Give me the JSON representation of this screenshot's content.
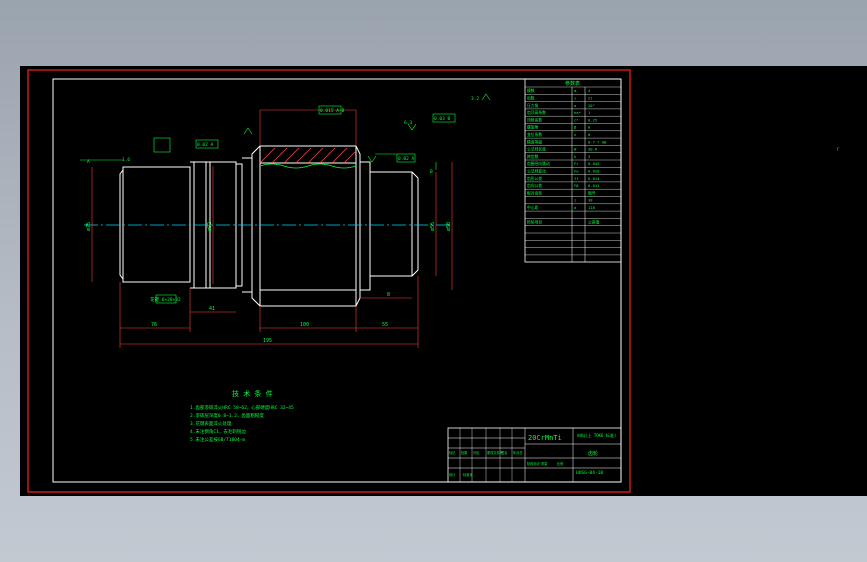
{
  "drawing": {
    "material": "20CrMnTi",
    "material_note": "材料(上 TOK6 标准)",
    "part_name": "齿轮",
    "drawing_number": "UUSG-04-10",
    "title_cells": [
      "标记",
      "处数",
      "分区",
      "更改文件号",
      "签名",
      "年月日"
    ],
    "bottom_cells": [
      "设计",
      "标准化",
      "阶段标记",
      "重量",
      "比例"
    ],
    "tech_title": "技 术 条 件",
    "tech_notes": [
      "1.齿部渗碳淬火HRC 58~62，心部硬度HRC 32~45",
      "2.渗碳层深度0.8~1.2，齿面粗糙度",
      "3.花键表面淬火处理",
      "4.未注倒角C1，去毛刺锐边",
      "5.未注公差按GB/T1804-m"
    ],
    "param_table_title": "参数表",
    "param_rows": [
      {
        "name": "模数",
        "sym": "m",
        "val": "4"
      },
      {
        "name": "齿数",
        "sym": "z",
        "val": "21"
      },
      {
        "name": "压力角",
        "sym": "α",
        "val": "20°"
      },
      {
        "name": "齿顶高系数",
        "sym": "ha*",
        "val": "1"
      },
      {
        "name": "顶隙系数",
        "sym": "c*",
        "val": "0.25"
      },
      {
        "name": "螺旋角",
        "sym": "β",
        "val": "0"
      },
      {
        "name": "变位系数",
        "sym": "x",
        "val": "0"
      },
      {
        "name": "精度等级",
        "sym": "",
        "val": "8-7-7 GB"
      },
      {
        "name": "公法线长度",
        "sym": "W",
        "val": "30.6"
      },
      {
        "name": "跨齿数",
        "sym": "k",
        "val": "3"
      },
      {
        "name": "齿圈径向跳动",
        "sym": "Fr",
        "val": "0.045"
      },
      {
        "name": "公法线变动",
        "sym": "Fw",
        "val": "0.028"
      },
      {
        "name": "齿形公差",
        "sym": "ff",
        "val": "0.014"
      },
      {
        "name": "齿向公差",
        "sym": "Fβ",
        "val": "0.011"
      },
      {
        "name": "配对齿轮",
        "sym": "",
        "val": "图号"
      },
      {
        "name": "",
        "sym": "z",
        "val": "38"
      },
      {
        "name": "中心距",
        "sym": "a",
        "val": "118"
      },
      {
        "name": "",
        "sym": "",
        "val": ""
      },
      {
        "name": "检验项目",
        "sym": "",
        "val": "公差值"
      },
      {
        "name": "",
        "sym": "",
        "val": ""
      },
      {
        "name": "",
        "sym": "",
        "val": ""
      },
      {
        "name": "",
        "sym": "",
        "val": ""
      },
      {
        "name": "",
        "sym": "",
        "val": ""
      },
      {
        "name": "",
        "sym": "",
        "val": ""
      }
    ],
    "dims": {
      "overall_len": "195",
      "len_left": "76",
      "len_center": "100",
      "len_right": "55",
      "len_spline": "41",
      "len_neck": "8",
      "dia_left": "ø75",
      "dia_gear": "ø92",
      "dia_right": "ø55",
      "dia_shaft": "ø50",
      "roughness_a": "3.2",
      "roughness_b": "6.3",
      "roughness_c": "1.6"
    },
    "labels": {
      "datum_a": "A",
      "datum_b": "B",
      "gdt_1": "0.02 A",
      "gdt_2": "0.015 A-B",
      "gdt_3": "0.03 B",
      "gdt_4": "0.02 A",
      "spline_note": "花键 6×28×32",
      "side_marker": "r"
    }
  },
  "colors": {
    "background": "#000000",
    "frame": "#ff2020",
    "border": "#ffffff",
    "annotation": "#00ff3c",
    "dimension": "#ff3c3c",
    "centerline": "#00d6ff",
    "hatch": "#ff5050",
    "workspace": "#aab2bc"
  }
}
